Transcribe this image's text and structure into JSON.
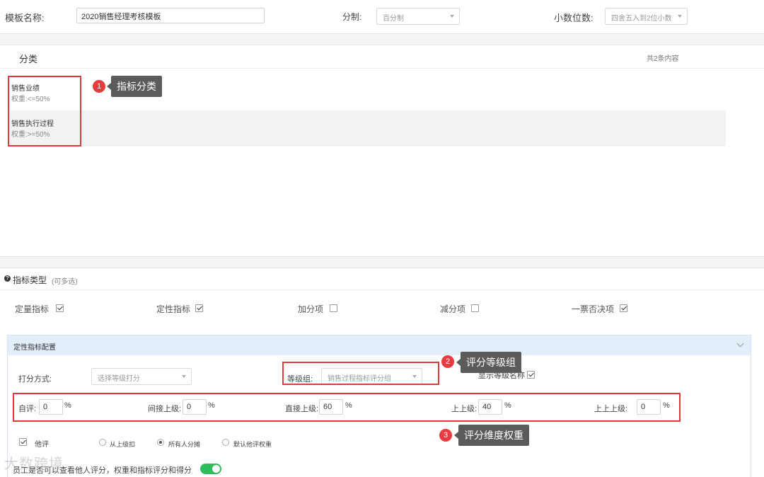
{
  "header": {
    "template_name_label": "模板名称:",
    "template_name_value": "2020销售经理考核模板",
    "scoring_label": "分制:",
    "scoring_value": "百分制",
    "decimal_label": "小数位数:",
    "decimal_value": "四舍五入到2位小数"
  },
  "category": {
    "title": "分类",
    "count": "共2条内容",
    "items": [
      {
        "name": "销售业绩",
        "weight": "权重:<=50%"
      },
      {
        "name": "销售执行过程",
        "weight": "权重:>=50%"
      }
    ]
  },
  "indicator_types": {
    "title": "指标类型",
    "hint": "(可多选)",
    "options": [
      {
        "label": "定量指标",
        "checked": true
      },
      {
        "label": "定性指标",
        "checked": true
      },
      {
        "label": "加分项",
        "checked": false
      },
      {
        "label": "减分项",
        "checked": false
      },
      {
        "label": "一票否决项",
        "checked": true
      }
    ]
  },
  "qual_config": {
    "title": "定性指标配置",
    "score_method_label": "打分方式:",
    "score_method_placeholder": "选择等级打分",
    "grade_group_label": "等级组:",
    "grade_group_value": "销售过程指标评分组",
    "show_grade_name_label": "显示等级名称",
    "show_grade_name_checked": true,
    "weights": [
      {
        "label": "自评:",
        "value": "0",
        "unit": "%"
      },
      {
        "label": "间接上级:",
        "value": "0",
        "unit": "%"
      },
      {
        "label": "直接上级:",
        "value": "60",
        "unit": "%"
      },
      {
        "label": "上上级:",
        "value": "40",
        "unit": "%"
      },
      {
        "label": "上上上级:",
        "value": "0",
        "unit": "%"
      }
    ],
    "others_label": "他评",
    "others_checked": true,
    "radio_options": [
      {
        "label": "从上级扣",
        "selected": false
      },
      {
        "label": "所有人分摊",
        "selected": true
      },
      {
        "label": "默认他评权重",
        "selected": false
      }
    ],
    "employee_view_label": "员工是否可以查看他人评分，权重和指标评分和得分",
    "employee_view_on": true
  },
  "annotations": [
    {
      "number": "1",
      "text": "指标分类"
    },
    {
      "number": "2",
      "text": "评分等级组"
    },
    {
      "number": "3",
      "text": "评分维度权重"
    }
  ],
  "watermark": "大数跨境",
  "colors": {
    "annotation_red": "#e0393e",
    "toggle_green": "#2dbd5b",
    "config_header_bg": "#e3eefb"
  }
}
